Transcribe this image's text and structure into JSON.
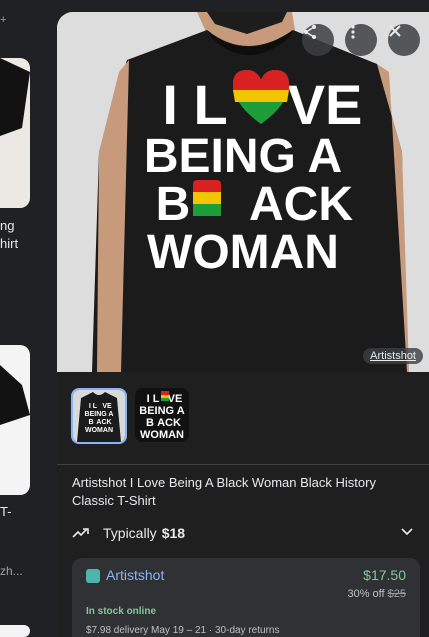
{
  "left_column": {
    "plus_sign": "+",
    "item1_line1": "ng",
    "item1_line2": "hirt",
    "item2_line1": "T-",
    "item3_text": "zh..."
  },
  "hero": {
    "image_name": "black-t-shirt-i-love-being-a-black-woman",
    "shirt_text_lines": [
      "I L",
      "VE",
      "BEING A",
      "B",
      "ACK",
      "WOMAN"
    ],
    "source_label": "Artistshot"
  },
  "thumbnails": [
    {
      "name": "shirt-model-thumbnail",
      "selected": true,
      "lines": [
        "I L",
        "VE",
        "BEING A",
        "B",
        "ACK",
        "WOMAN"
      ]
    },
    {
      "name": "design-closeup-thumbnail",
      "selected": false,
      "lines": [
        "I L",
        "VE",
        "BEING A",
        "B",
        "ACK",
        "WOMAN"
      ]
    }
  ],
  "product": {
    "title": "Artistshot I Love Being A Black Woman Black History Classic T-Shirt",
    "typically_label": "Typically",
    "typically_price": "$18"
  },
  "offer": {
    "store": "Artistshot",
    "price": "$17.50",
    "discount": "30% off",
    "original_price": "$25",
    "stock": "In stock online",
    "delivery": "$7.98 delivery May 19 – 21",
    "separator": "·",
    "returns": "30-day returns"
  },
  "icons": [
    "share-icon",
    "more-vert-icon",
    "close-icon",
    "trending-icon",
    "chevron-down-icon",
    "store-icon"
  ],
  "colors": {
    "accent_link": "#8ab4f8",
    "price_green": "#81c995",
    "panel_bg": "#1f1f1f"
  }
}
